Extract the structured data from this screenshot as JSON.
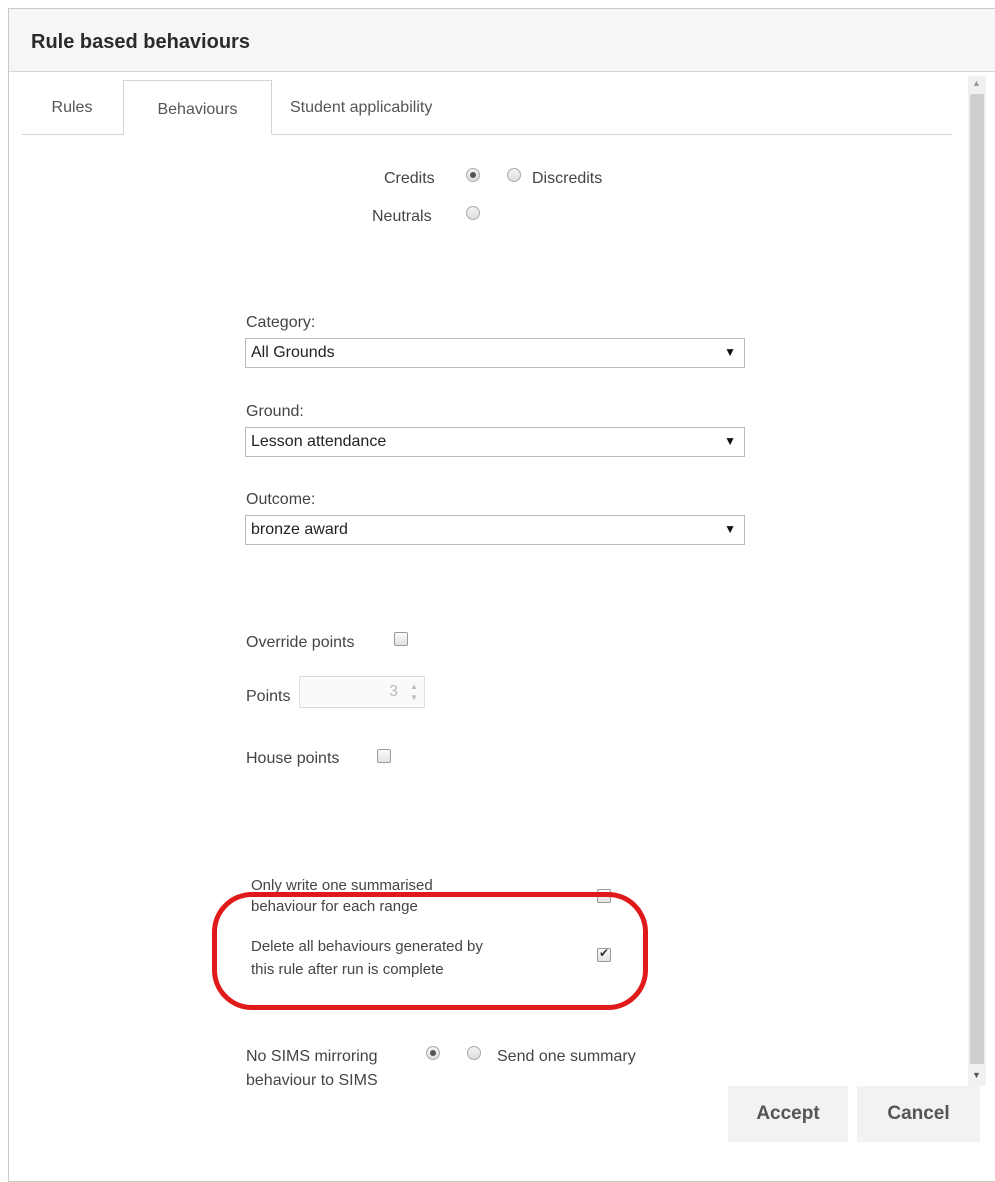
{
  "dialog": {
    "title": "Rule based behaviours"
  },
  "tabs": [
    {
      "label": "Rules"
    },
    {
      "label": "Behaviours"
    },
    {
      "label": "Student applicability"
    }
  ],
  "behaviour_type": {
    "credits_label": "Credits",
    "discredits_label": "Discredits",
    "neutrals_label": "Neutrals",
    "selected": "Credits"
  },
  "category": {
    "label": "Category:",
    "value": "All Grounds"
  },
  "ground": {
    "label": "Ground:",
    "value": "Lesson attendance"
  },
  "outcome": {
    "label": "Outcome:",
    "value": "bronze award"
  },
  "override_points": {
    "label": "Override points",
    "checked": false
  },
  "points": {
    "label": "Points",
    "value": "3"
  },
  "house_points": {
    "label": "House points",
    "checked": false
  },
  "summarise": {
    "label_line1": "Only write one summarised",
    "label_line2": "behaviour for each range",
    "checked": false
  },
  "delete_behaviours": {
    "label_line1": "Delete all behaviours generated by",
    "label_line2": "this rule after run is complete",
    "checked": true
  },
  "sims": {
    "no_mirroring_label": "No SIMS mirroring",
    "send_summary_label_line1": "Send one summary",
    "send_summary_label_line2": "behaviour to SIMS",
    "selected": "No SIMS mirroring"
  },
  "buttons": {
    "accept": "Accept",
    "cancel": "Cancel"
  },
  "colors": {
    "highlight": "#e01a1a"
  }
}
